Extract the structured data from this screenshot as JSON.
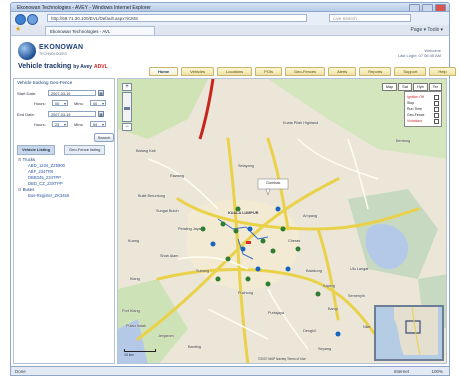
{
  "window": {
    "title": "Ekonowan Technologies - AVEY - Windows Internet Explorer",
    "address": "http://69.71.30.100/EVL/Default.aspx?iCMS",
    "search_placeholder": "Live Search",
    "tab_label": "Ekonowan Technologies - AVL",
    "tools": "Page ▾  Tools ▾"
  },
  "header": {
    "logo_name": "EKONOWAN",
    "logo_tagline": "TECHNOLOGIES",
    "app_title_prefix": "Vehicle tracking",
    "app_title_suffix": "by Avey",
    "app_title_badge": "ADVL",
    "user_line1": "Welcome",
    "user_line2": "Last Login: 07 06:45 AM"
  },
  "menu": [
    "Home",
    "Vehicles",
    "Locations",
    "POIs",
    "Geo-Fences",
    "Alerts",
    "Reports",
    "Support",
    "Help"
  ],
  "panel": {
    "title": "Vehicle tracking Geo-Fence",
    "start_label": "Start Date:",
    "start_date": "2007-03-19",
    "hours_label": "Hours:",
    "hours_value": "00",
    "mins_label": "Mins:",
    "mins_value": "00",
    "end_label": "End Date:",
    "end_date": "2007-03-19",
    "hours2_value": "23",
    "mins2_value": "59",
    "search_button": "Search",
    "tab_vehicles": "Vehicle Listing",
    "tab_geofence": "Geo-Fence listing",
    "groups": [
      {
        "name": "Trucks",
        "items": [
          "ABD_1234_ZZ5900",
          "ABF_234TR6",
          "DBB345_234TPP",
          "DBD_CZ_23XTPP"
        ]
      },
      {
        "name": "Buses",
        "items": [
          "Bus-Register_ZK3456"
        ]
      }
    ]
  },
  "map": {
    "map_types": [
      "Map",
      "Sat",
      "Hyb",
      "Ter"
    ],
    "legend": [
      "Ignition Off",
      "Stop",
      "Run Time",
      "Geo-Fence",
      "Violations"
    ],
    "labels": {
      "highland": "Kuala Pilah Highland",
      "gombak": "Gombak",
      "rawang": "Rawang",
      "klang": "Klang",
      "kl": "KUALA LUMPUR",
      "petaling": "Petaling Jaya",
      "shah_alam": "Shah Alam",
      "subang": "Subang",
      "putrajaya": "Putrajaya",
      "kajang": "Kajang",
      "bangi": "Bangi",
      "semenyih": "Semenyih",
      "nilai": "Nilai",
      "banting": "Banting",
      "sepang": "Sepang",
      "ampang": "Ampang",
      "cheras": "Cheras",
      "selayang": "Selayang",
      "bentong": "Bentong",
      "lenggeng": "Lenggeng",
      "kuang": "Kuang",
      "pulau_indah": "Pulau Indah",
      "jenjarom": "Jenjarom",
      "puchong": "Puchong",
      "seremban": "Seremban",
      "bukit_beruntung": "Bukit Beruntung",
      "sg_buloh": "Sungai Buloh",
      "port_klang": "Port Klang",
      "balakong": "Balakong",
      "dengkil": "Dengkil",
      "batang_kali": "Batang Kali",
      "ulu_langat": "Ulu Langat"
    },
    "scale_label": "10 km",
    "attribution": "©2007 MAP Navteq Terms of Use"
  },
  "statusbar": {
    "left": "Done",
    "zone": "Internet",
    "zoom": "100%"
  }
}
